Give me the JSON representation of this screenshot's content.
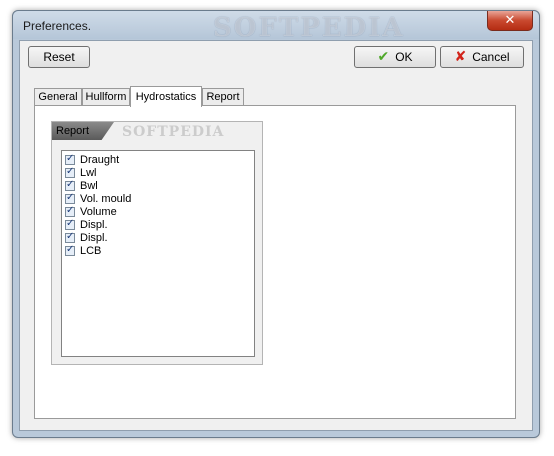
{
  "window": {
    "title": "Preferences.",
    "watermark": "SOFTPEDIA",
    "close_symbol": "✕"
  },
  "toolbar": {
    "reset_label": "Reset",
    "ok_label": "OK",
    "cancel_label": "Cancel",
    "ok_icon": "check-icon",
    "cancel_icon": "cross-icon"
  },
  "tabs": [
    {
      "label": "General"
    },
    {
      "label": "Hullform"
    },
    {
      "label": "Hydrostatics",
      "active": true
    },
    {
      "label": "Report"
    }
  ],
  "report_group": {
    "title": "Report",
    "watermark": "SOFTPEDIA",
    "items": [
      {
        "label": "Draught",
        "checked": true
      },
      {
        "label": "Lwl",
        "checked": true
      },
      {
        "label": "Bwl",
        "checked": true
      },
      {
        "label": "Vol. mould",
        "checked": true
      },
      {
        "label": "Volume",
        "checked": true
      },
      {
        "label": "Displ.",
        "checked": true
      },
      {
        "label": "Displ.",
        "checked": true
      },
      {
        "label": "LCB",
        "checked": true
      }
    ]
  },
  "colors": {
    "ok_check": "#4fa82a",
    "cancel_cross": "#d2241b",
    "close_button": "#c9492f",
    "frame": "#b9c9da"
  }
}
